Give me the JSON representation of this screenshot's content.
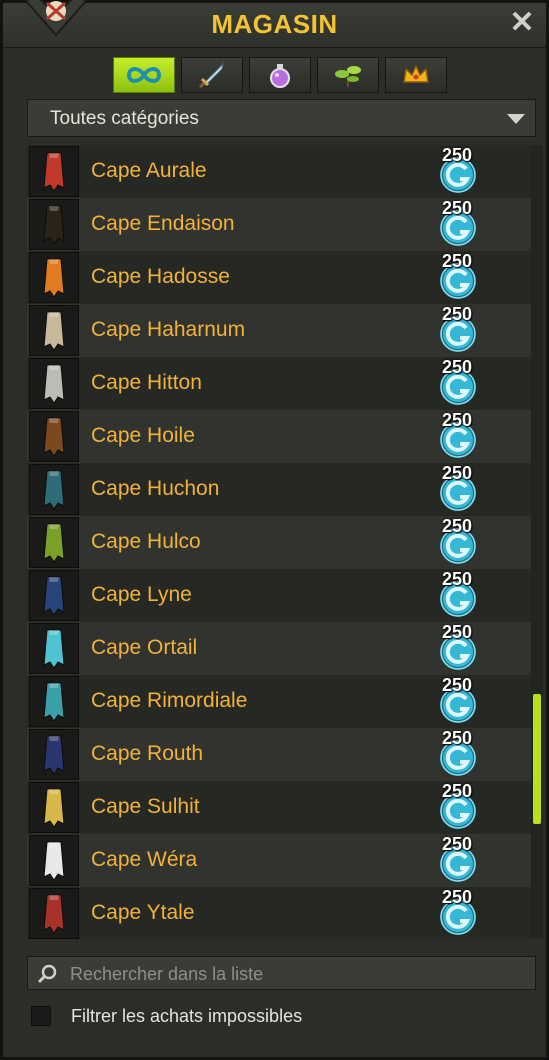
{
  "title": "MAGASIN",
  "category_dropdown": {
    "selected": "Toutes catégories"
  },
  "tabs": [
    {
      "icon": "infinity-icon",
      "active": true
    },
    {
      "icon": "sword-icon",
      "active": false
    },
    {
      "icon": "potion-icon",
      "active": false
    },
    {
      "icon": "plant-icon",
      "active": false
    },
    {
      "icon": "crown-icon",
      "active": false
    }
  ],
  "items": [
    {
      "name": "Cape Aurale",
      "price": "250",
      "icon_color": "#c0392b"
    },
    {
      "name": "Cape Endaison",
      "price": "250",
      "icon_color": "#2a2418"
    },
    {
      "name": "Cape Hadosse",
      "price": "250",
      "icon_color": "#e07b20"
    },
    {
      "name": "Cape Haharnum",
      "price": "250",
      "icon_color": "#c8b89a"
    },
    {
      "name": "Cape Hitton",
      "price": "250",
      "icon_color": "#bcbcb4"
    },
    {
      "name": "Cape Hoile",
      "price": "250",
      "icon_color": "#7a4a1e"
    },
    {
      "name": "Cape Huchon",
      "price": "250",
      "icon_color": "#2e6c7a"
    },
    {
      "name": "Cape Hulco",
      "price": "250",
      "icon_color": "#7aa02a"
    },
    {
      "name": "Cape Lyne",
      "price": "250",
      "icon_color": "#27457a"
    },
    {
      "name": "Cape Ortail",
      "price": "250",
      "icon_color": "#4fc3d2"
    },
    {
      "name": "Cape Rimordiale",
      "price": "250",
      "icon_color": "#3aa0a8"
    },
    {
      "name": "Cape Routh",
      "price": "250",
      "icon_color": "#2b3670"
    },
    {
      "name": "Cape Sulhit",
      "price": "250",
      "icon_color": "#d8b64a"
    },
    {
      "name": "Cape Wéra",
      "price": "250",
      "icon_color": "#e8e8e8"
    },
    {
      "name": "Cape Ytale",
      "price": "250",
      "icon_color": "#a8322a"
    }
  ],
  "search": {
    "placeholder": "Rechercher dans la liste",
    "value": ""
  },
  "filter": {
    "label": "Filtrer les achats impossibles",
    "checked": false
  },
  "scroll": {
    "position_fraction": 0.83
  },
  "colors": {
    "accent": "#b8e21b",
    "title": "#f2c433",
    "item_name": "#f2b23a",
    "coin": "#35b8d6"
  }
}
